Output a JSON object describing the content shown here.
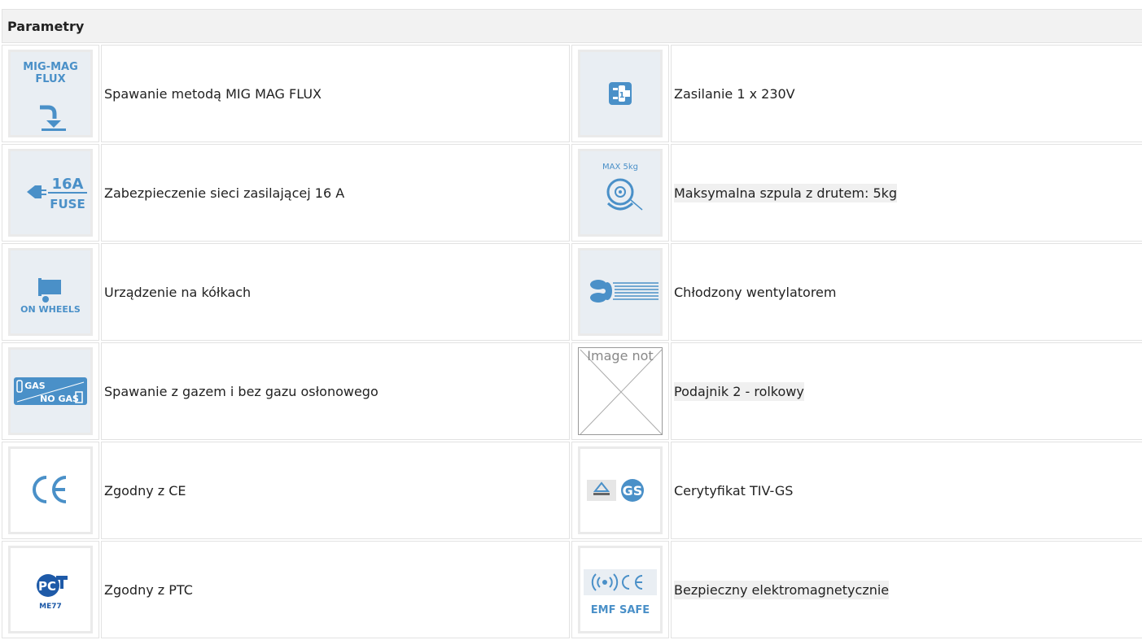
{
  "table": {
    "header": "Parametry",
    "rows": [
      {
        "left": {
          "icon": "mig-mag-flux-icon",
          "text": "Spawanie metodą MIG MAG FLUX"
        },
        "right": {
          "icon": "plug-1-phase-icon",
          "text": "Zasilanie 1 x 230V"
        }
      },
      {
        "left": {
          "icon": "fuse-16a-icon",
          "text": "Zabezpieczenie sieci zasilającej 16 A"
        },
        "right": {
          "icon": "wire-spool-icon",
          "text": "Maksymalna szpula z drutem: 5kg"
        }
      },
      {
        "left": {
          "icon": "on-wheels-icon",
          "text": "Urządzenie na kółkach"
        },
        "right": {
          "icon": "fan-cooling-icon",
          "text": "Chłodzony wentylatorem"
        }
      },
      {
        "left": {
          "icon": "gas-no-gas-icon",
          "text": "Spawanie z gazem i bez gazu osłonowego"
        },
        "right": {
          "icon": "broken-image-icon",
          "text": "Podajnik 2 - rolkowy",
          "alt": "Image not"
        }
      },
      {
        "left": {
          "icon": "ce-mark-icon",
          "text": "Zgodny z CE"
        },
        "right": {
          "icon": "tuv-gs-icon",
          "text": "Cerytyfikat TIV-GS"
        }
      },
      {
        "left": {
          "icon": "pct-me77-icon",
          "text": "Zgodny z PTC"
        },
        "right": {
          "icon": "emf-safe-icon",
          "text": "Bezpieczny elektromagnetycznie"
        }
      }
    ]
  },
  "icon_text": {
    "mig": [
      "MIG-MAG",
      "FLUX"
    ],
    "fuse": [
      "16A",
      "FUSE"
    ],
    "spool": "MAX 5kg",
    "wheels": "ON WHEELS",
    "gas": [
      "GAS",
      "NO GAS"
    ],
    "pct": "ME77",
    "emf": "EMF SAFE"
  },
  "colors": {
    "icon_blue": "#4a90c8",
    "icon_bg": "#e9eef3",
    "border": "#e2e2e2",
    "header_bg": "#f2f2f2"
  }
}
